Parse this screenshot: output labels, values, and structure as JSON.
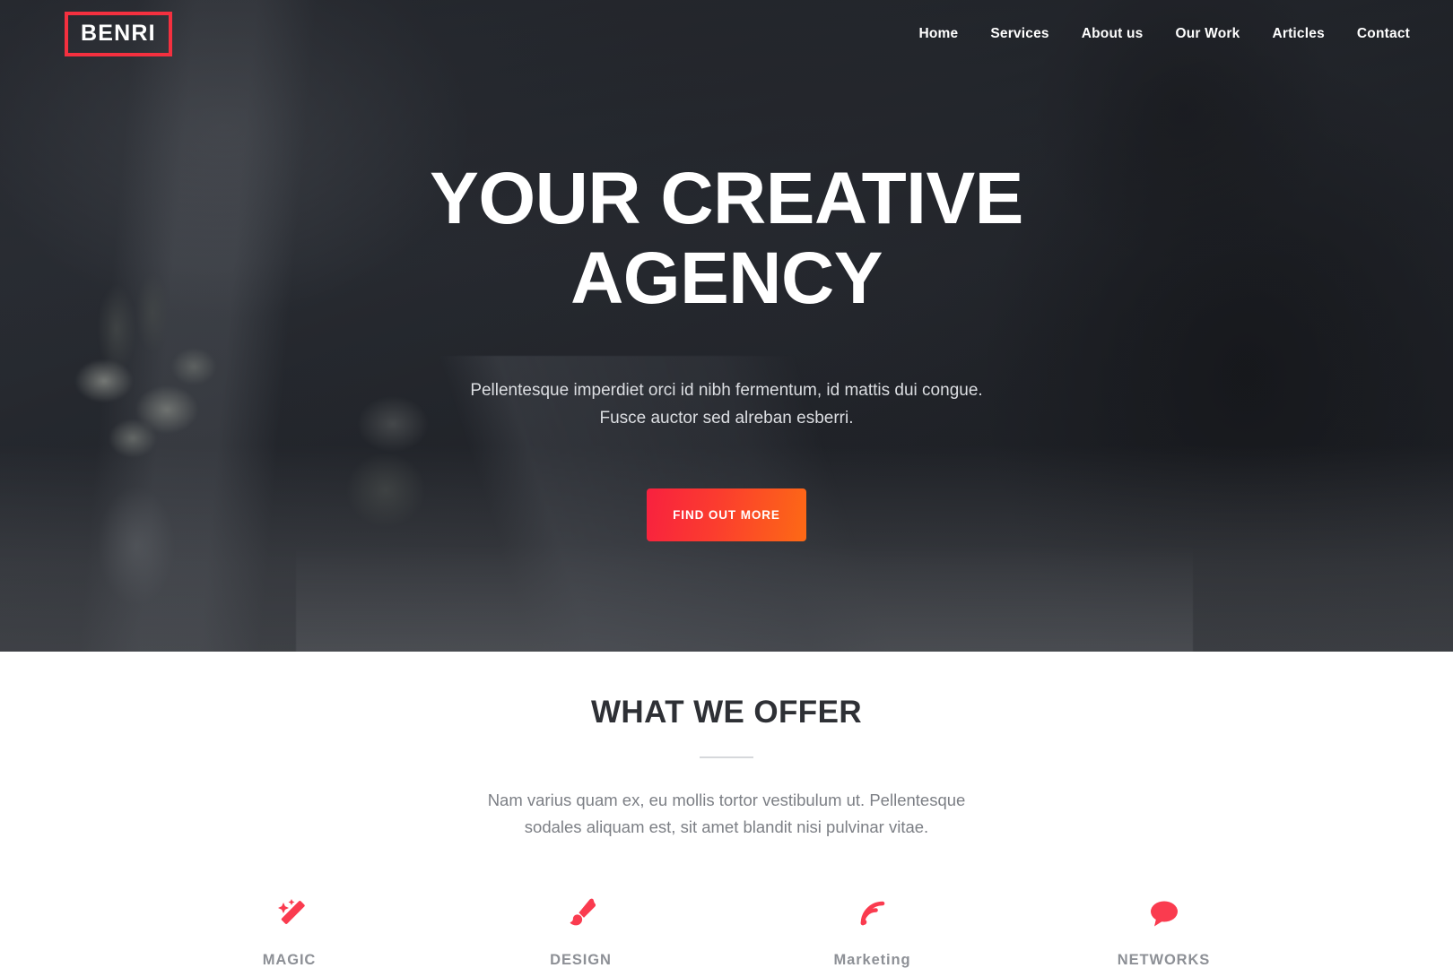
{
  "brand": {
    "name": "BENRI",
    "accent": "#f4303f"
  },
  "nav": {
    "items": [
      {
        "label": "Home"
      },
      {
        "label": "Services"
      },
      {
        "label": "About us"
      },
      {
        "label": "Our Work"
      },
      {
        "label": "Articles"
      },
      {
        "label": "Contact"
      }
    ]
  },
  "hero": {
    "title_line1": "YOUR CREATIVE",
    "title_line2": "AGENCY",
    "subtitle_line1": "Pellentesque imperdiet orci id nibh fermentum, id mattis dui congue.",
    "subtitle_line2": "Fusce auctor sed alreban esberri.",
    "cta_label": "FIND OUT MORE",
    "cta_gradient_start": "#f8213f",
    "cta_gradient_end": "#fd6a15"
  },
  "offer": {
    "title": "WHAT WE OFFER",
    "text_line1": "Nam varius quam ex, eu mollis tortor vestibulum ut. Pellentesque",
    "text_line2": "sodales aliquam est, sit amet blandit nisi pulvinar vitae.",
    "services": [
      {
        "label": "MAGIC",
        "icon": "magic-wand-icon",
        "color": "#fa3b4f"
      },
      {
        "label": "DESIGN",
        "icon": "paintbrush-icon",
        "color": "#fa3b4f"
      },
      {
        "label": "Marketing",
        "icon": "rss-signal-icon",
        "color": "#fa3b4f"
      },
      {
        "label": "NETWORKS",
        "icon": "speech-bubble-icon",
        "color": "#fa3b4f"
      }
    ]
  }
}
